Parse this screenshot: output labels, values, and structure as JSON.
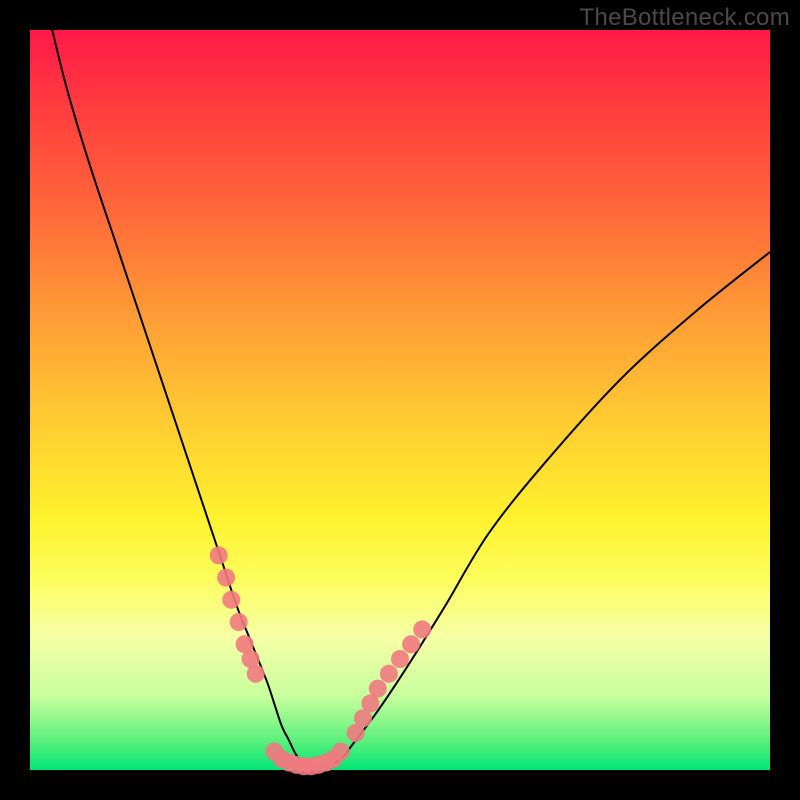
{
  "watermark": "TheBottleneck.com",
  "chart_data": {
    "type": "line",
    "title": "",
    "xlabel": "",
    "ylabel": "",
    "xlim": [
      0,
      100
    ],
    "ylim": [
      0,
      100
    ],
    "grid": false,
    "legend": false,
    "series": [
      {
        "name": "black-curve",
        "color": "#000000",
        "x": [
          3,
          5,
          8,
          12,
          16,
          20,
          24,
          26,
          28,
          30,
          32,
          33,
          34,
          35,
          36,
          37,
          38,
          40,
          42,
          44,
          47,
          51,
          56,
          62,
          70,
          80,
          90,
          100
        ],
        "y": [
          100,
          92,
          82,
          70,
          58,
          46,
          34,
          28,
          22,
          17,
          12,
          9,
          6,
          4,
          2,
          1,
          0.5,
          0.5,
          1.5,
          4,
          8,
          14,
          22,
          32,
          42,
          53,
          62,
          70
        ]
      },
      {
        "name": "pink-markers-left",
        "color": "#ef7a80",
        "marker": true,
        "x": [
          25.5,
          26.5,
          27.2,
          28.2,
          29.0,
          29.8,
          30.5
        ],
        "y": [
          29,
          26,
          23,
          20,
          17,
          15,
          13
        ]
      },
      {
        "name": "pink-markers-bottom",
        "color": "#ef7a80",
        "marker": true,
        "x": [
          33.0,
          34.0,
          35.0,
          36.0,
          37.0,
          38.0,
          39.0,
          40.0,
          41.0,
          42.0
        ],
        "y": [
          2.5,
          1.5,
          1.0,
          0.7,
          0.5,
          0.5,
          0.7,
          1.0,
          1.5,
          2.5
        ]
      },
      {
        "name": "pink-markers-right",
        "color": "#ef7a80",
        "marker": true,
        "x": [
          44.0,
          45.0,
          46.0,
          47.0,
          48.5,
          50.0,
          51.5,
          53.0
        ],
        "y": [
          5,
          7,
          9,
          11,
          13,
          15,
          17,
          19
        ]
      }
    ],
    "annotations": []
  }
}
